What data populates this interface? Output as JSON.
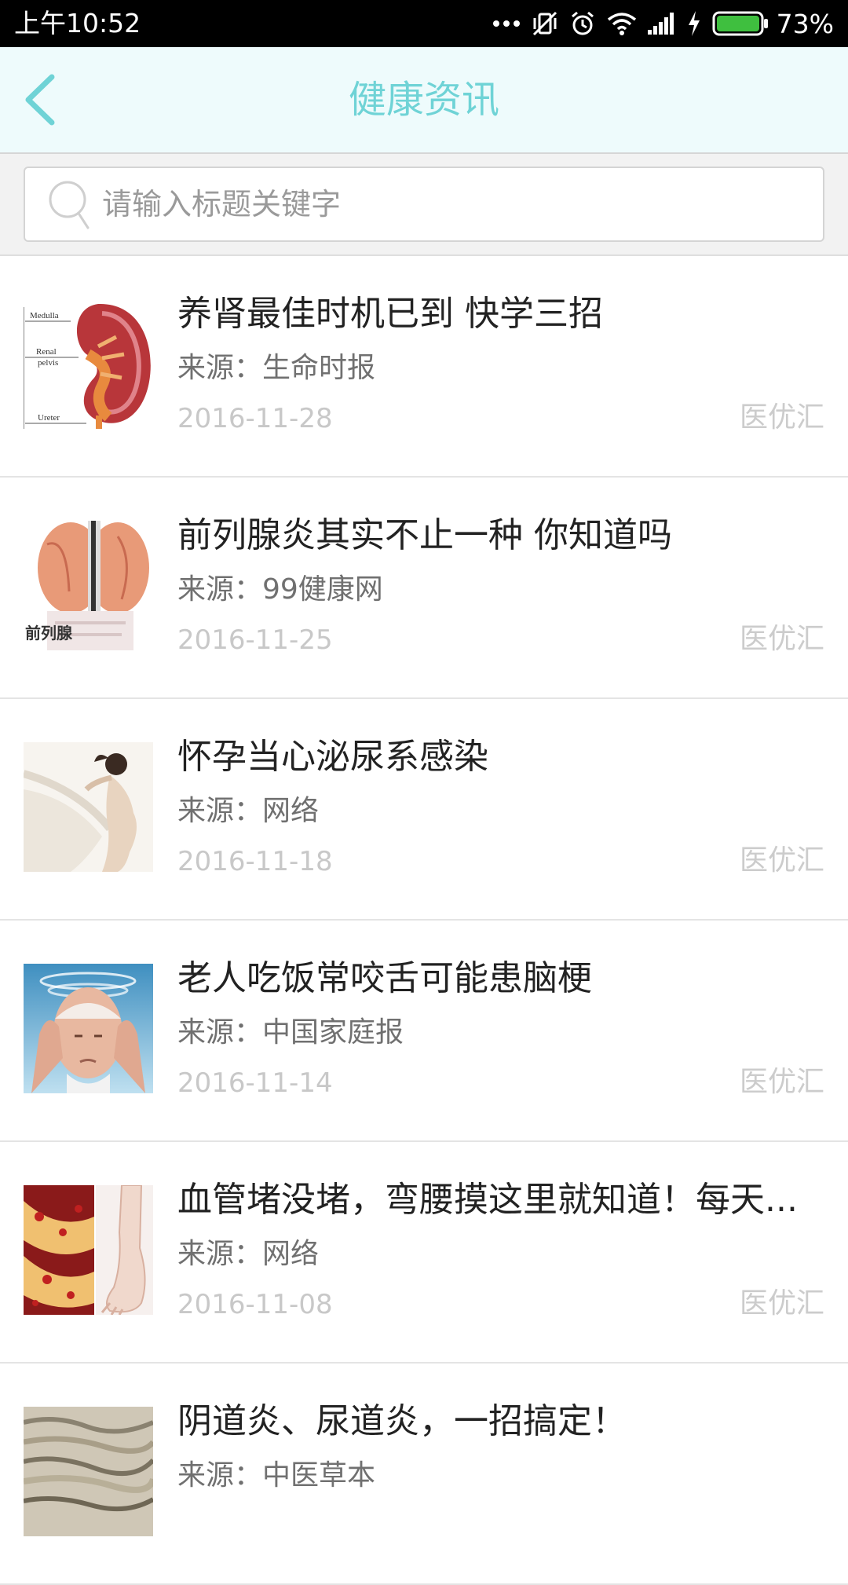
{
  "status_bar": {
    "time": "上午10:52",
    "battery": "73%",
    "icons": [
      "more-dots-icon",
      "vibrate-off-icon",
      "alarm-icon",
      "wifi-icon",
      "signal-icon",
      "charging-icon",
      "battery-icon"
    ]
  },
  "header": {
    "title": "健康资讯",
    "back_icon": "chevron-left-icon"
  },
  "search": {
    "placeholder": "请输入标题关键字",
    "value": "",
    "icon": "search-icon"
  },
  "colors": {
    "accent": "#6fd3d6",
    "header_bg": "#eefbfc",
    "battery": "#3fbf3f"
  },
  "news": [
    {
      "title": "养肾最佳时机已到 快学三招",
      "source": "来源：生命时报",
      "date": "2016-11-28",
      "brand": "医优汇",
      "thumb_labels": [
        "Medulla",
        "Renal",
        "pelvis",
        "Ureter"
      ]
    },
    {
      "title": "前列腺炎其实不止一种 你知道吗",
      "source": "来源：99健康网",
      "date": "2016-11-25",
      "brand": "医优汇",
      "thumb_labels": [
        "前列腺"
      ]
    },
    {
      "title": "怀孕当心泌尿系感染",
      "source": "来源：网络",
      "date": "2016-11-18",
      "brand": "医优汇"
    },
    {
      "title": "老人吃饭常咬舌可能患脑梗",
      "source": "来源：中国家庭报",
      "date": "2016-11-14",
      "brand": "医优汇"
    },
    {
      "title": "血管堵没堵，弯腰摸这里就知道！每天...",
      "source": "来源：网络",
      "date": "2016-11-08",
      "brand": "医优汇"
    },
    {
      "title": "阴道炎、尿道炎，一招搞定！",
      "source": "来源：中医草本",
      "date": "",
      "brand": ""
    }
  ]
}
